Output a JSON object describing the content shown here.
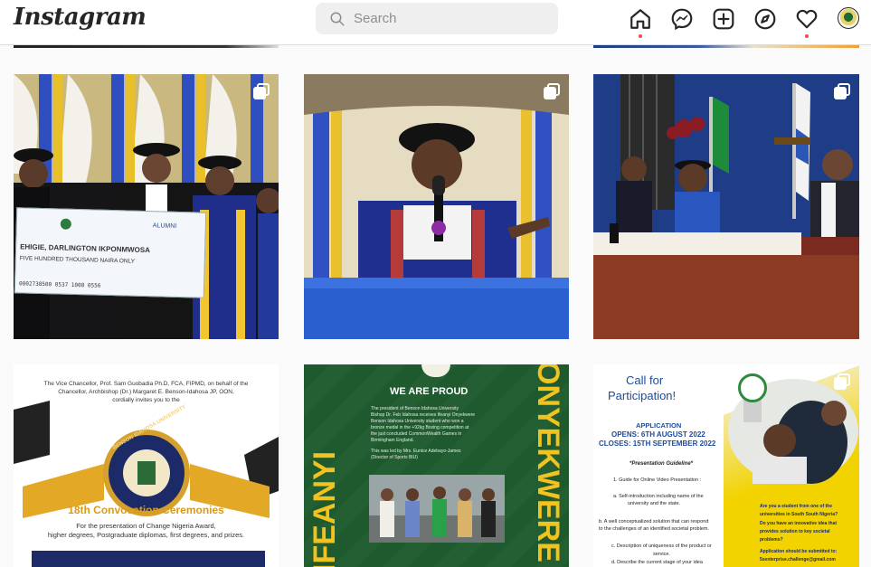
{
  "header": {
    "logo": "Instagram",
    "search_placeholder": "Search"
  },
  "nav_icons": [
    "home-icon",
    "messenger-icon",
    "new-post-icon",
    "explore-icon",
    "activity-heart-icon",
    "profile-avatar"
  ],
  "posts": [
    {
      "cheque_brand": "ALUMNI",
      "cheque_payee": "EHIGIE, DARLINGTON IKPONMWOSA",
      "cheque_amount": "FIVE HUNDRED THOUSAND NAIRA ONLY",
      "cheque_code": "0002738500 0537 1008 0556"
    },
    {},
    {},
    {
      "intro": "The Vice Chancellor, Prof. Sam Guobadia Ph.D, FCA, FIPMD, on behalf of the Chancellor, Archbishop (Dr.) Margaret E. Benson-Idahosa JP, OON, cordially invites you to the",
      "intro_line1": "The Vice Chancellor, Prof. Sam Guobadia Ph.D, FCA, FIPMD, on behalf of the",
      "intro_line2": "Chancellor, Archbishop (Dr.) Margaret E. Benson-Idahosa JP, OON,",
      "intro_line3": "cordially invites you to the",
      "seal_text": "BENSON IDAHOSA UNIVERSITY",
      "heading": "18th  Convocation Ceremonies",
      "sub1": "For the presentation of Change Nigeria Award,",
      "sub2": "higher degrees, Postgraduate diplomas, first degrees, and prizes."
    },
    {
      "title": "WE ARE PROUD",
      "body1": "The president of Benson Idahosa University",
      "body2": "Bishop Dr. Feb Idahosa receives Ifeanyi Onyekwere",
      "body3": "Benson Idahosa University student who won a",
      "body4": "bronze medal in the +92kg Boxing competition at",
      "body5": "the just concluded CommonWealth Games in",
      "body6": "Birmingham England.",
      "body7": "This was led by Mrs. Eunice Adebayo-James",
      "body8": "(Director of Sports BIU)",
      "name_left": "IFEANYI",
      "name_right": "ONYEKWERE"
    },
    {
      "title1": "Call for",
      "title2": "Participation!",
      "app1": "APPLICATION",
      "app2": "OPENS: 6TH AUGUST 2022",
      "app3": "CLOSES: 15TH SEPTEMBER 2022",
      "guide_title": "*Presentation Guideline*",
      "g1": "1. Guide for Online Video Presentation :",
      "g2": "a. Self-introduction including name of the",
      "g3": "university and the state.",
      "g4": "b. A well conceptualized solution that can respond",
      "g5": "to the challenges of an identified societal problem.",
      "g6": "c. Description of uniqueness of the product or",
      "g7": "service.",
      "g8": "d. Describe the current stage of your idea",
      "q1": "Are you a student from one of the",
      "q2": "universities in South South Nigeria?",
      "q3": "Do you have an innovative idea that",
      "q4": "provides solution to key societal",
      "q5": "problems?",
      "q6": "Application should be submitted to:",
      "q7": "5senterprise.challenge@gmail.com"
    }
  ],
  "colors": {
    "accent_notification": "#ed4956",
    "bg": "#fafafa",
    "post3_bg": "#1e5a2d",
    "post6_title": "#1c4c9a",
    "post6_yellow": "#f2d300"
  }
}
